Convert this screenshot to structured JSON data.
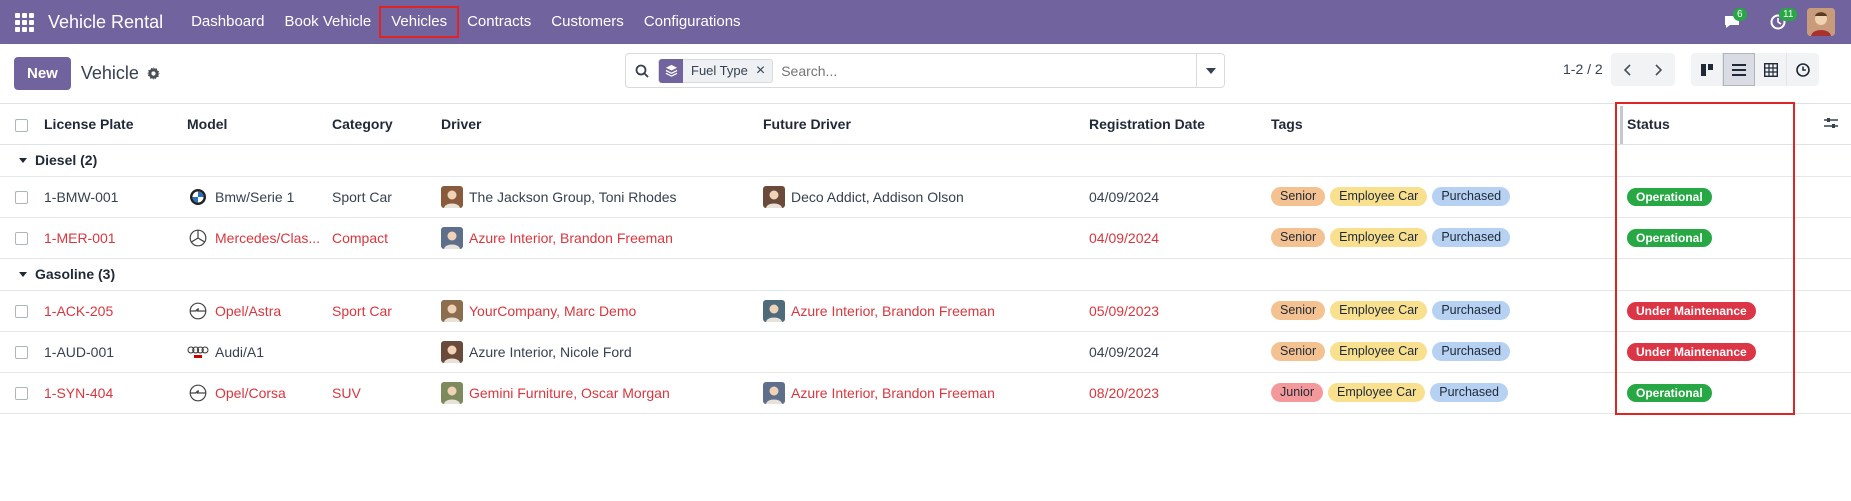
{
  "navbar": {
    "brand": "Vehicle Rental",
    "menu": [
      "Dashboard",
      "Book Vehicle",
      "Vehicles",
      "Contracts",
      "Customers",
      "Configurations"
    ],
    "chat_badge": "6",
    "activity_badge": "11"
  },
  "control": {
    "new_label": "New",
    "title": "Vehicle",
    "facet": "Fuel Type",
    "search_placeholder": "Search...",
    "pager": "1-2 / 2"
  },
  "table": {
    "headers": [
      "License Plate",
      "Model",
      "Category",
      "Driver",
      "Future Driver",
      "Registration Date",
      "Tags",
      "Status"
    ],
    "groups": [
      {
        "label": "Diesel (2)",
        "rows": [
          {
            "plate": "1-BMW-001",
            "model": "Bmw/Serie 1",
            "category": "Sport Car",
            "driver": "The Jackson Group, Toni Rhodes",
            "future_driver": "Deco Addict, Addison Olson",
            "date": "04/09/2024",
            "tags": [
              "Senior",
              "Employee Car",
              "Purchased"
            ],
            "status": "Operational",
            "red": false,
            "logo": "bmw"
          },
          {
            "plate": "1-MER-001",
            "model": "Mercedes/Clas...",
            "category": "Compact",
            "driver": "Azure Interior, Brandon Freeman",
            "future_driver": "",
            "date": "04/09/2024",
            "tags": [
              "Senior",
              "Employee Car",
              "Purchased"
            ],
            "status": "Operational",
            "red": true,
            "logo": "mercedes"
          }
        ]
      },
      {
        "label": "Gasoline (3)",
        "rows": [
          {
            "plate": "1-ACK-205",
            "model": "Opel/Astra",
            "category": "Sport Car",
            "driver": "YourCompany, Marc Demo",
            "future_driver": "Azure Interior, Brandon Freeman",
            "date": "05/09/2023",
            "tags": [
              "Senior",
              "Employee Car",
              "Purchased"
            ],
            "status": "Under Maintenance",
            "red": true,
            "logo": "opel"
          },
          {
            "plate": "1-AUD-001",
            "model": "Audi/A1",
            "category": "",
            "driver": "Azure Interior, Nicole Ford",
            "future_driver": "",
            "date": "04/09/2024",
            "tags": [
              "Senior",
              "Employee Car",
              "Purchased"
            ],
            "status": "Under Maintenance",
            "red": false,
            "logo": "audi"
          },
          {
            "plate": "1-SYN-404",
            "model": "Opel/Corsa",
            "category": "SUV",
            "driver": "Gemini Furniture, Oscar Morgan",
            "future_driver": "Azure Interior, Brandon Freeman",
            "date": "08/20/2023",
            "tags": [
              "Junior",
              "Employee Car",
              "Purchased"
            ],
            "status": "Operational",
            "red": true,
            "logo": "opel"
          }
        ]
      }
    ]
  },
  "colors": {
    "navbar": "#71639e",
    "operational": "#28a745",
    "maintenance": "#dc3545",
    "link_red": "#d9363e",
    "highlight": "#e02424"
  }
}
